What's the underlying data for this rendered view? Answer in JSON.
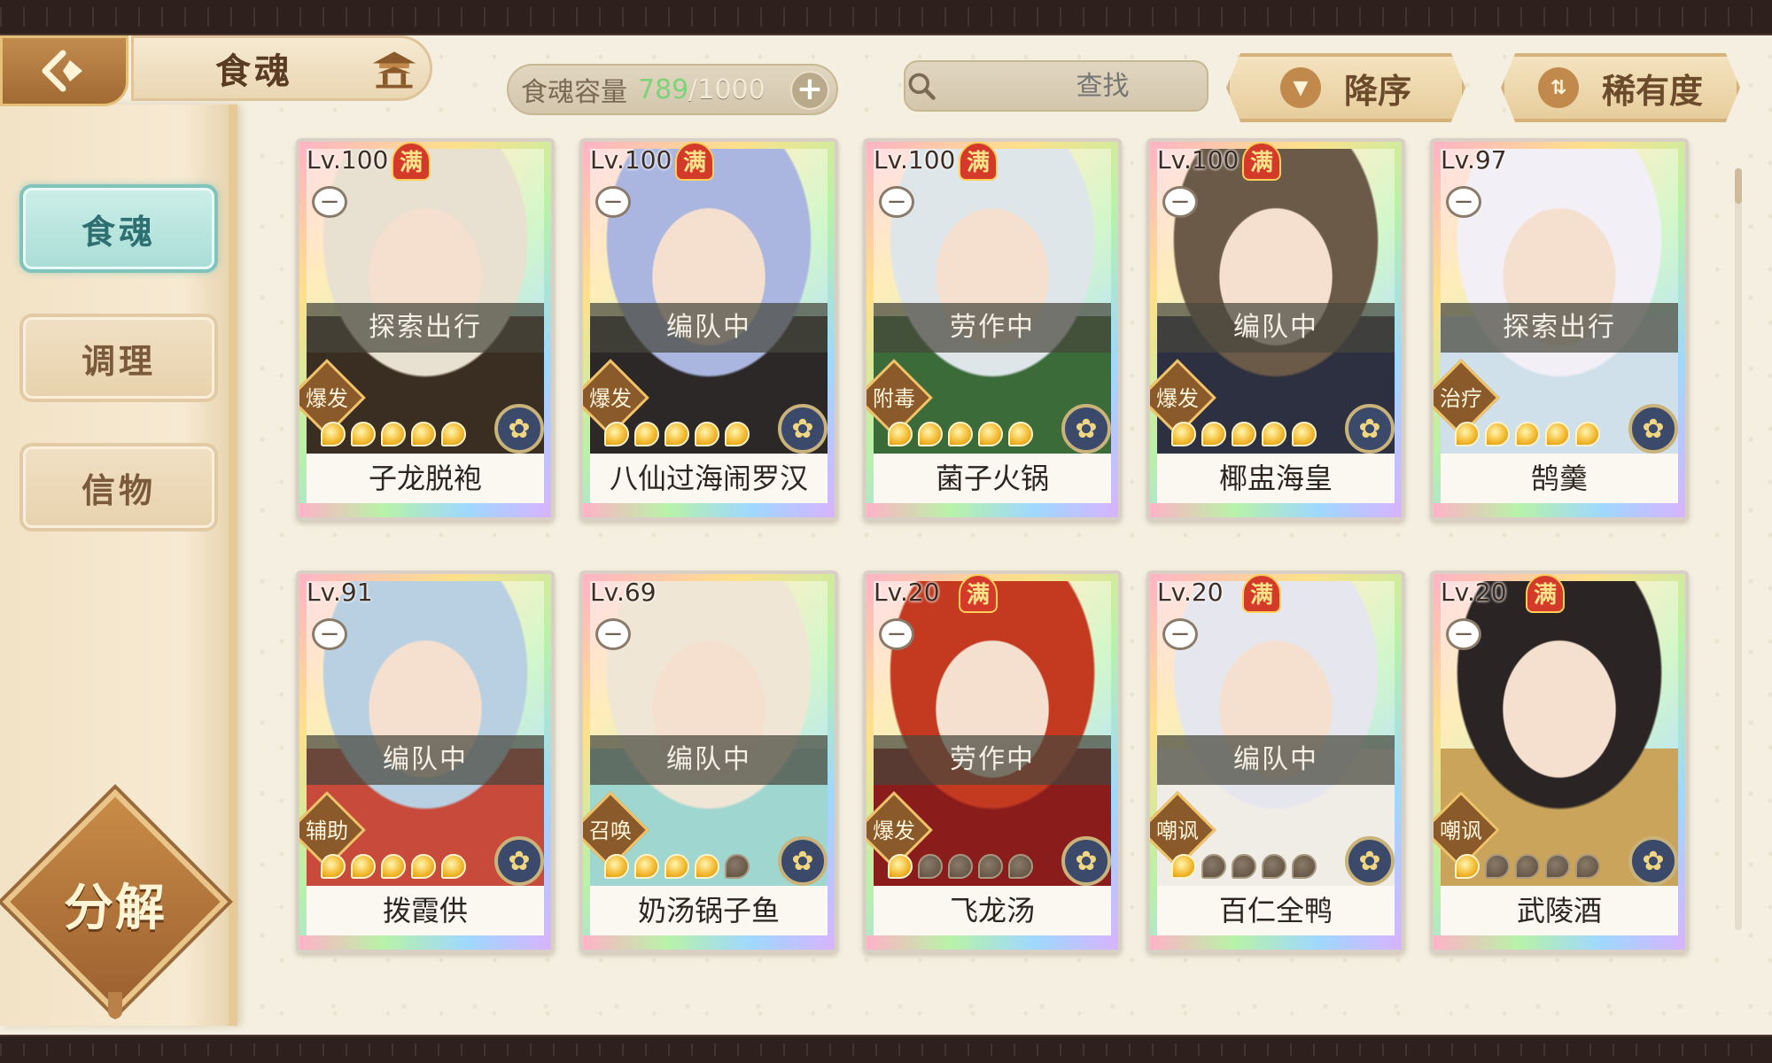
{
  "header": {
    "title": "食魂",
    "capacity_label": "食魂容量",
    "capacity_used": "789",
    "capacity_total": "/1000",
    "capacity_add": "+",
    "search_placeholder": "查找",
    "clear_label": "✕",
    "sort_order_label": "降序",
    "sort_key_label": "稀有度"
  },
  "sidebar": {
    "items": [
      {
        "label": "食魂",
        "active": true
      },
      {
        "label": "调理",
        "active": false
      },
      {
        "label": "信物",
        "active": false
      }
    ],
    "decompose_label": "分解"
  },
  "bowl_glyph": "一",
  "full_glyph": "满",
  "cards": [
    {
      "level": "Lv.100",
      "full": true,
      "status": "探索出行",
      "role": "爆发",
      "stars": 5,
      "name": "子龙脱袍",
      "hair": "#e8e0d0",
      "robe": "#3a2e22"
    },
    {
      "level": "Lv.100",
      "full": true,
      "status": "编队中",
      "role": "爆发",
      "stars": 5,
      "name": "八仙过海闹罗汉",
      "hair": "#aab6e0",
      "robe": "#2c2828"
    },
    {
      "level": "Lv.100",
      "full": true,
      "status": "劳作中",
      "role": "附毒",
      "stars": 5,
      "name": "菌子火锅",
      "hair": "#dfe6ea",
      "robe": "#3c6b3a"
    },
    {
      "level": "Lv.100",
      "full": true,
      "status": "编队中",
      "role": "爆发",
      "stars": 5,
      "name": "椰盅海皇",
      "hair": "#6b5a48",
      "robe": "#2c3040"
    },
    {
      "level": "Lv.97",
      "full": false,
      "status": "探索出行",
      "role": "治疗",
      "stars": 5,
      "name": "鹄羹",
      "hair": "#f2f0f6",
      "robe": "#cfe0ea"
    },
    {
      "level": "Lv.91",
      "full": false,
      "status": "编队中",
      "role": "辅助",
      "stars": 5,
      "name": "拨霞供",
      "hair": "#b9d0e2",
      "robe": "#c84a3a"
    },
    {
      "level": "Lv.69",
      "full": false,
      "status": "编队中",
      "role": "召唤",
      "stars": 4,
      "name": "奶汤锅子鱼",
      "hair": "#efe6d6",
      "robe": "#9fd6cf"
    },
    {
      "level": "Lv.20",
      "full": true,
      "status": "劳作中",
      "role": "爆发",
      "stars": 1,
      "name": "飞龙汤",
      "hair": "#c43a20",
      "robe": "#8a1c1c"
    },
    {
      "level": "Lv.20",
      "full": true,
      "status": "编队中",
      "role": "嘲讽",
      "stars": 1,
      "name": "百仁全鸭",
      "hair": "#e6e6ee",
      "robe": "#f0ece6"
    },
    {
      "level": "Lv.20",
      "full": true,
      "status": "",
      "role": "嘲讽",
      "stars": 1,
      "name": "武陵酒",
      "hair": "#2a2424",
      "robe": "#c9a45a"
    }
  ],
  "colors": {
    "accent_teal": "#a9ddd6",
    "gold": "#e7cd9c",
    "capacity_used": "#7ed27a"
  }
}
